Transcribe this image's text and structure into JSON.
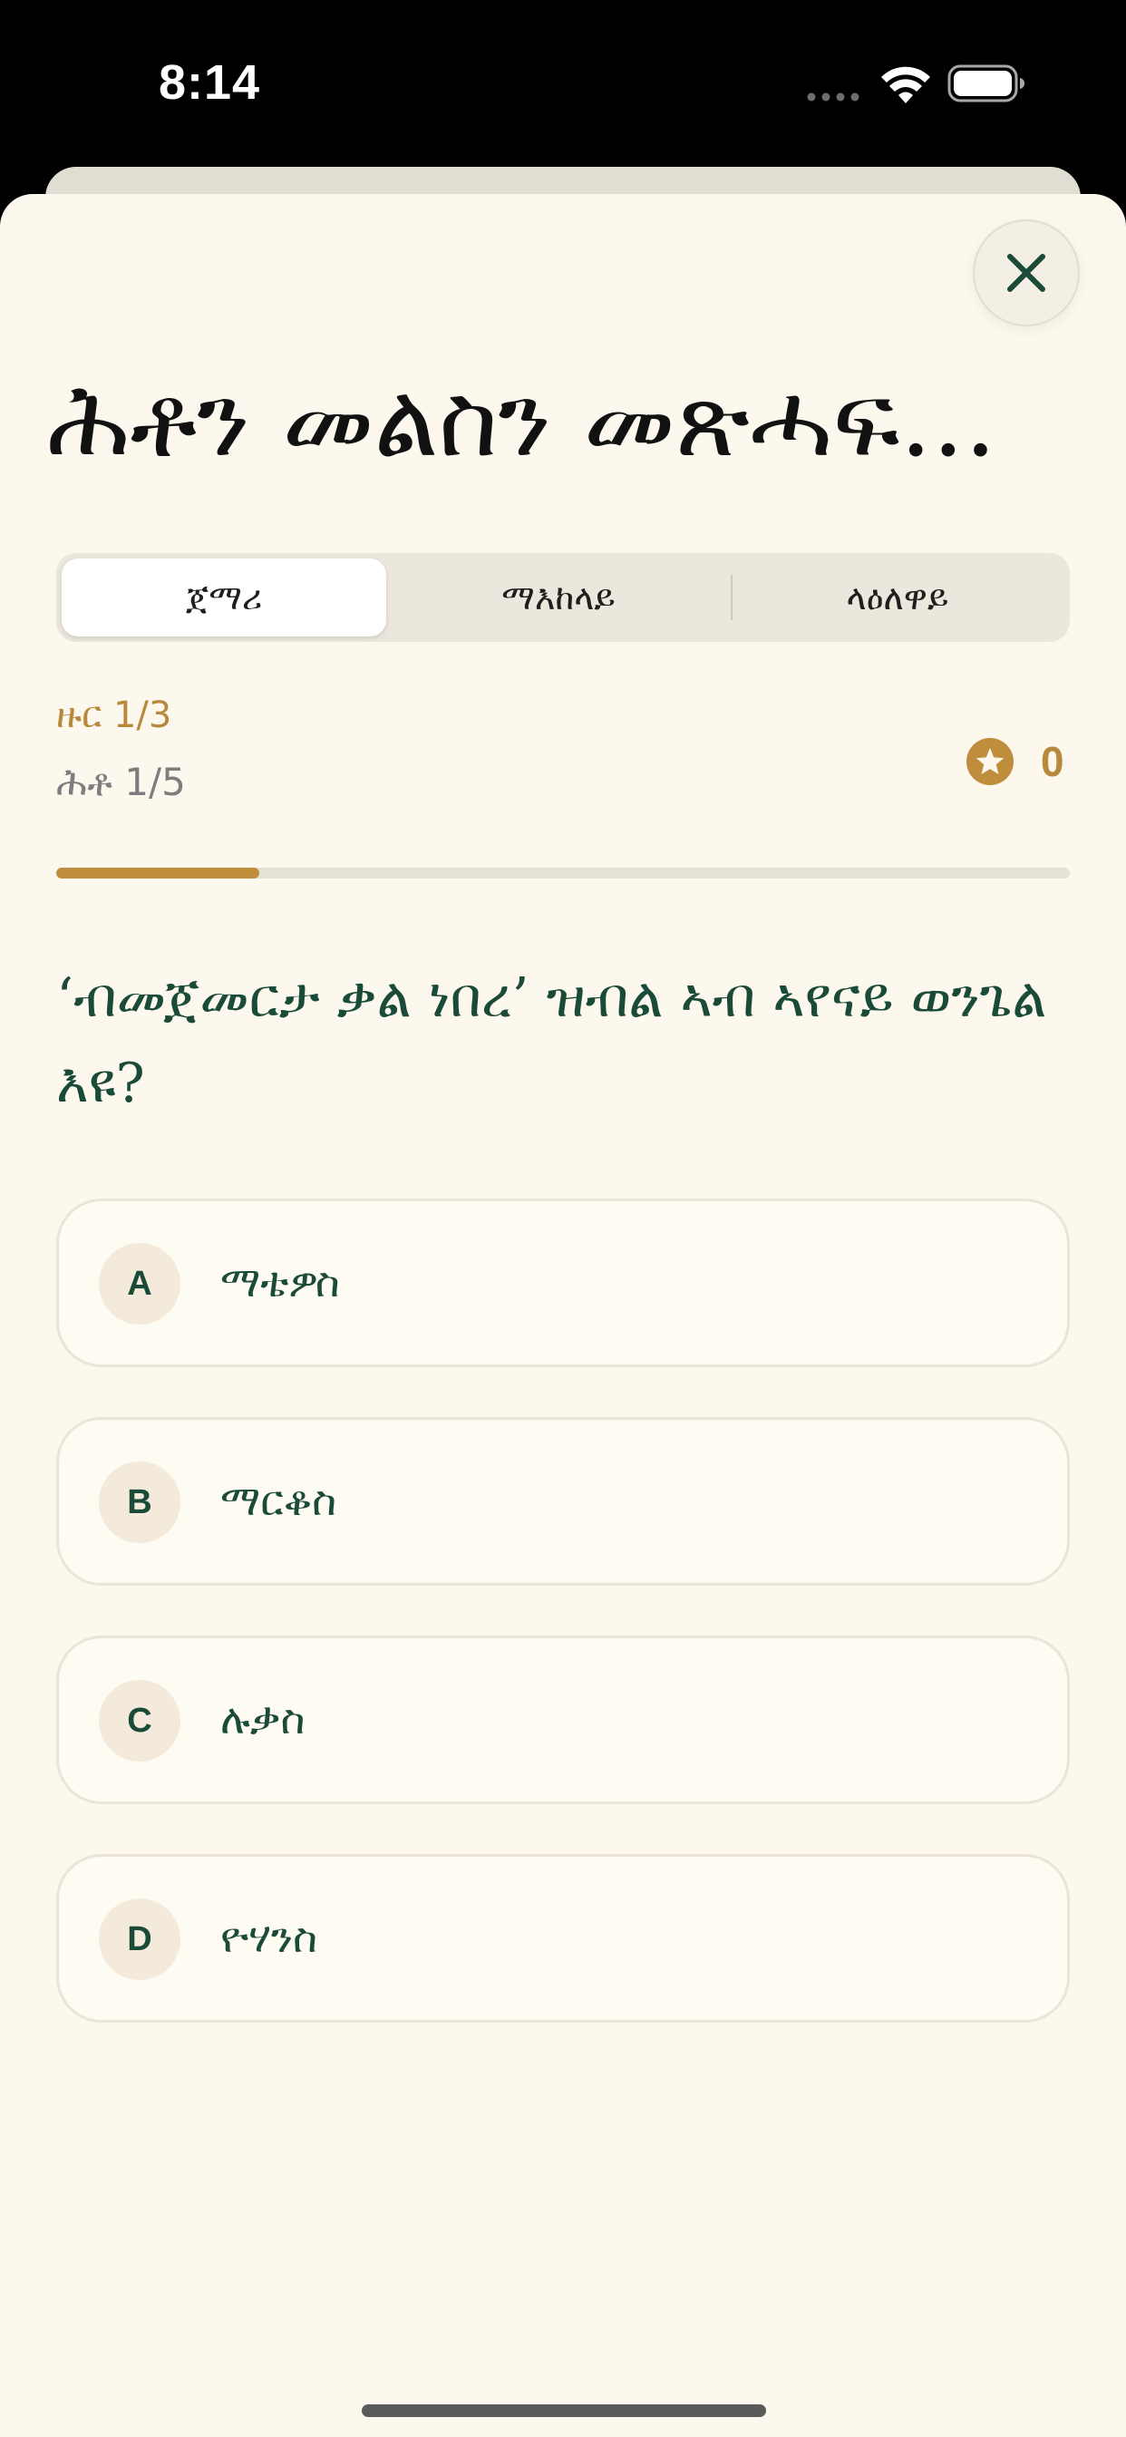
{
  "status_bar": {
    "time": "8:14"
  },
  "sheet": {
    "title": "ሕቶን መልስን መጽሓፍ...",
    "close_icon": "close-x-icon"
  },
  "tabs": [
    {
      "label": "ጀማሪ",
      "selected": true
    },
    {
      "label": "ማእከላይ",
      "selected": false
    },
    {
      "label": "ላዕለዋይ",
      "selected": false
    }
  ],
  "quiz": {
    "round_label": "ዙር 1/3",
    "question_label": "ሕቶ 1/5",
    "score": "0",
    "progress": 0.2,
    "question": "‘ብመጀመርታ ቃል ነበረ’ ዝብል ኣብ ኣየናይ ወንጌል እዩ?",
    "options": [
      {
        "letter": "A",
        "text": "ማቴዎስ"
      },
      {
        "letter": "B",
        "text": "ማርቆስ"
      },
      {
        "letter": "C",
        "text": "ሉቃስ"
      },
      {
        "letter": "D",
        "text": "ዮሃንስ"
      }
    ]
  },
  "colors": {
    "accent_gold": "#bf8e3c",
    "text_green": "#1a4a38",
    "sheet_bg": "#fcf8ee"
  }
}
